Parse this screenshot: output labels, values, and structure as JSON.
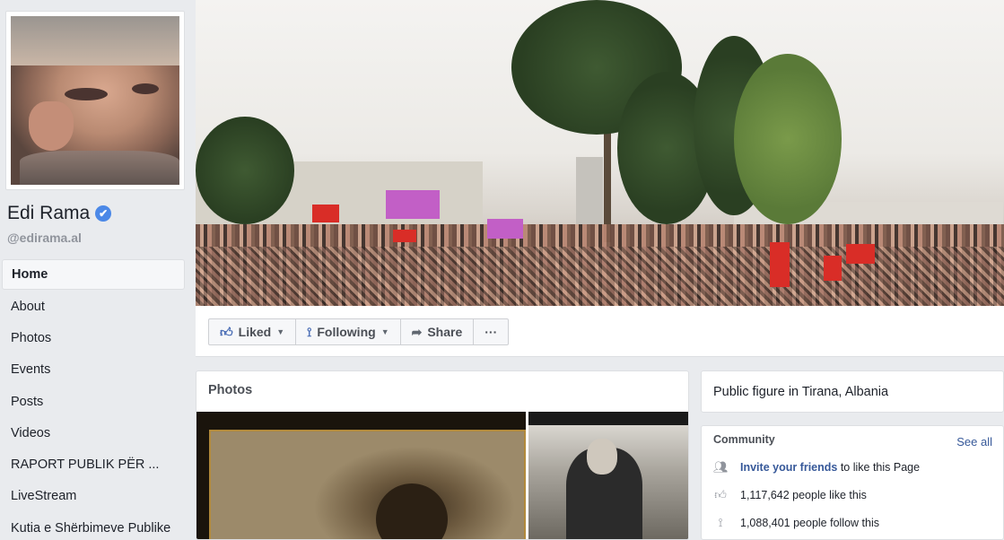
{
  "profile": {
    "name": "Edi Rama",
    "verified_icon": "✔",
    "username": "@edirama.al"
  },
  "nav": {
    "items": [
      {
        "label": "Home"
      },
      {
        "label": "About"
      },
      {
        "label": "Photos"
      },
      {
        "label": "Events"
      },
      {
        "label": "Posts"
      },
      {
        "label": "Videos"
      },
      {
        "label": "RAPORT PUBLIK PËR ..."
      },
      {
        "label": "LiveStream"
      },
      {
        "label": "Kutia e Shërbimeve Publike"
      }
    ]
  },
  "actions": {
    "liked": "Liked",
    "following": "Following",
    "share": "Share",
    "more": "···"
  },
  "photos": {
    "title": "Photos"
  },
  "info": {
    "text": "Public figure in Tirana, Albania"
  },
  "community": {
    "title": "Community",
    "see_all": "See all",
    "invite_link": "Invite your friends",
    "invite_rest": " to like this Page",
    "likes": "1,117,642 people like this",
    "follows": "1,088,401 people follow this"
  },
  "colors": {
    "accent": "#4267b2",
    "link": "#365899",
    "background": "#e9ebee"
  }
}
